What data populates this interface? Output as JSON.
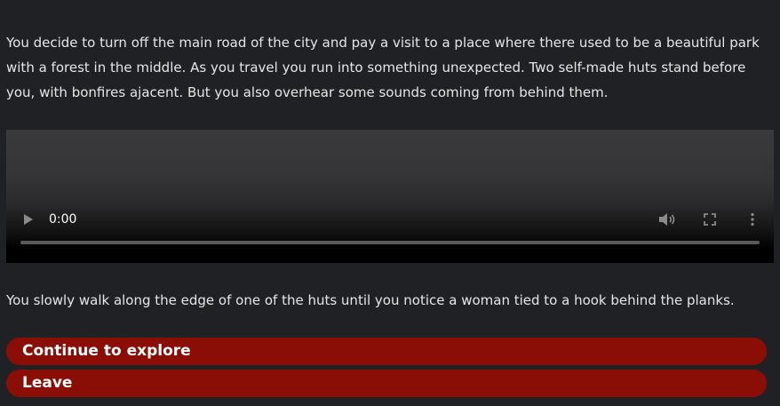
{
  "story": {
    "intro_text": "You decide to turn off the main road of the city and pay a visit to a place where there used to be a beautiful park with a forest in the middle. As you travel you run into something unexpected. Two self-made huts stand before you, with bonfires ajacent. But you also overhear some sounds coming from behind them.",
    "outro_text": "You slowly walk along the edge of one of the huts until you notice a woman tied to a hook behind the planks."
  },
  "video": {
    "time": "0:00",
    "progress": 0,
    "icons": {
      "play": "play-icon",
      "volume": "volume-icon",
      "fullscreen": "fullscreen-icon",
      "more": "more-options-icon"
    }
  },
  "choices": [
    {
      "label": "Continue to explore"
    },
    {
      "label": "Leave"
    }
  ],
  "colors": {
    "background": "#202124",
    "button": "#8b0e06",
    "text": "#e6e6e6"
  }
}
